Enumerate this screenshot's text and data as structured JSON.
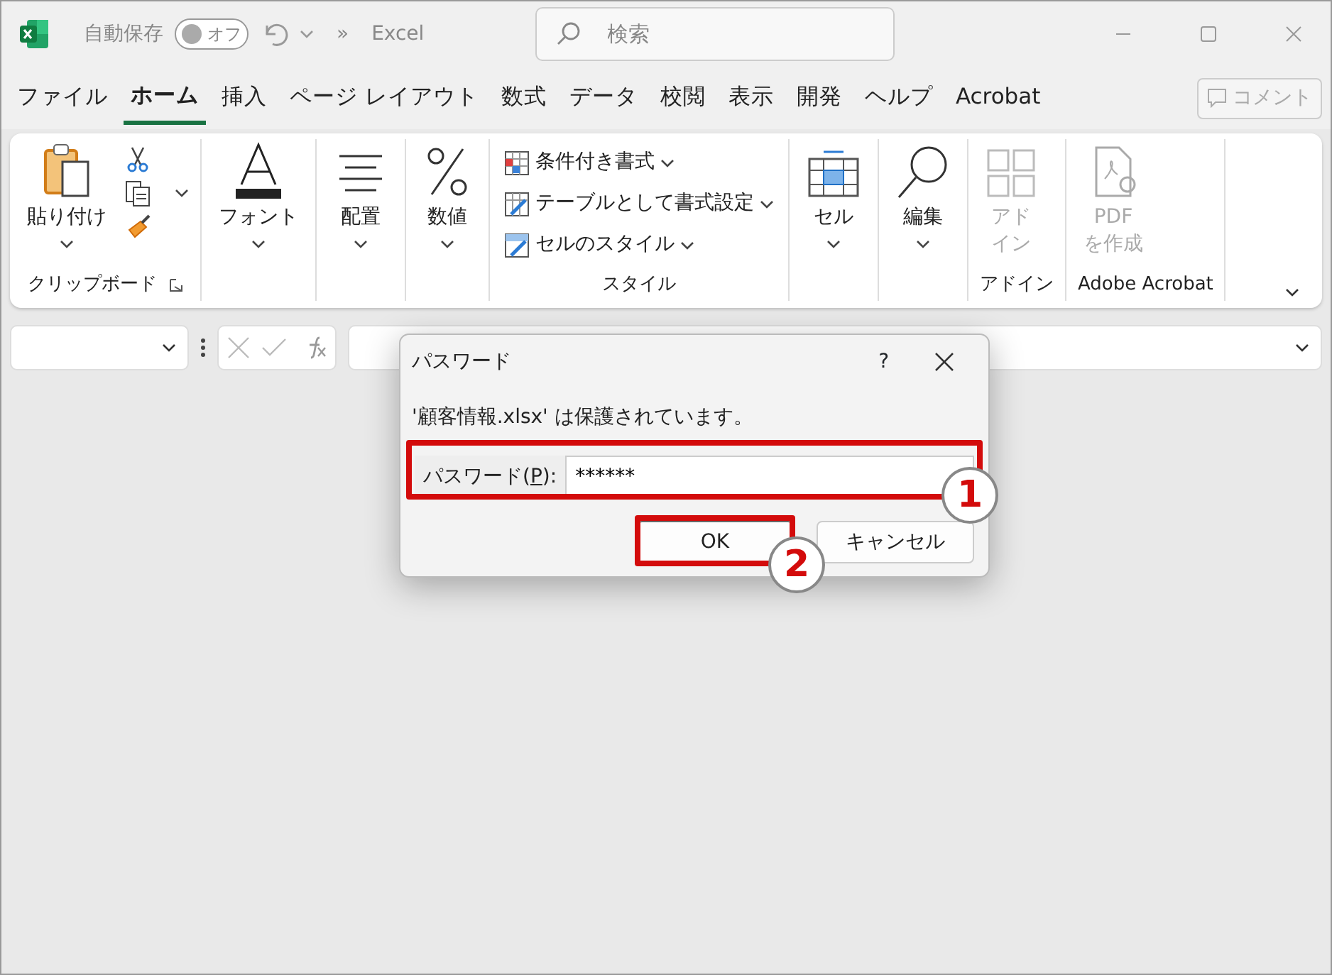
{
  "titlebar": {
    "autosave_label": "自動保存",
    "autosave": {
      "on": false,
      "text": "オフ"
    },
    "more": "»",
    "app_name": "Excel",
    "search": {
      "placeholder": "検索"
    }
  },
  "tabs": [
    {
      "label": "ファイル",
      "selected": false
    },
    {
      "label": "ホーム",
      "selected": true
    },
    {
      "label": "挿入",
      "selected": false
    },
    {
      "label": "ページ レイアウト",
      "selected": false
    },
    {
      "label": "数式",
      "selected": false
    },
    {
      "label": "データ",
      "selected": false
    },
    {
      "label": "校閲",
      "selected": false
    },
    {
      "label": "表示",
      "selected": false
    },
    {
      "label": "開発",
      "selected": false
    },
    {
      "label": "ヘルプ",
      "selected": false
    },
    {
      "label": "Acrobat",
      "selected": false
    }
  ],
  "comment_button": {
    "label": "コメント",
    "disabled": true
  },
  "ribbon": {
    "groups": [
      {
        "label": "クリップボード",
        "launcher": true,
        "buttons": [
          {
            "kind": "large",
            "label": "貼り付け",
            "dropdown": true
          },
          {
            "kind": "small"
          },
          {
            "kind": "small",
            "dropdown": true
          },
          {
            "kind": "small"
          }
        ]
      },
      {
        "buttons": [
          {
            "kind": "large",
            "label": "フォント",
            "dropdown": true
          }
        ]
      },
      {
        "buttons": [
          {
            "kind": "large",
            "label": "配置",
            "dropdown": true
          }
        ]
      },
      {
        "buttons": [
          {
            "kind": "large",
            "label": "数値",
            "dropdown": true
          }
        ]
      },
      {
        "label": "スタイル",
        "buttons": [
          {
            "kind": "row",
            "label": "条件付き書式",
            "dropdown": true
          },
          {
            "kind": "row",
            "label": "テーブルとして書式設定",
            "dropdown": true
          },
          {
            "kind": "row",
            "label": "セルのスタイル",
            "dropdown": true
          }
        ]
      },
      {
        "buttons": [
          {
            "kind": "large",
            "label": "セル",
            "dropdown": true
          }
        ]
      },
      {
        "buttons": [
          {
            "kind": "large",
            "label": "編集",
            "dropdown": true
          }
        ]
      },
      {
        "label": "アドイン",
        "buttons": [
          {
            "kind": "large",
            "lines": [
              "アド",
              "イン"
            ],
            "disabled": true
          }
        ]
      },
      {
        "label": "Adobe Acrobat",
        "buttons": [
          {
            "kind": "large",
            "lines": [
              "PDF",
              "を作成"
            ],
            "disabled": true
          }
        ]
      }
    ]
  },
  "dialog": {
    "title": "パスワード",
    "help": "?",
    "message": "'顧客情報.xlsx' は保護されています。",
    "field": {
      "label_before": "パスワード(",
      "access_key": "P",
      "label_after": "):",
      "value": "******"
    },
    "buttons": [
      {
        "label": "OK",
        "default": true
      },
      {
        "label": "キャンセル",
        "default": false
      }
    ]
  },
  "callouts": [
    {
      "number": "1"
    },
    {
      "number": "2"
    }
  ]
}
